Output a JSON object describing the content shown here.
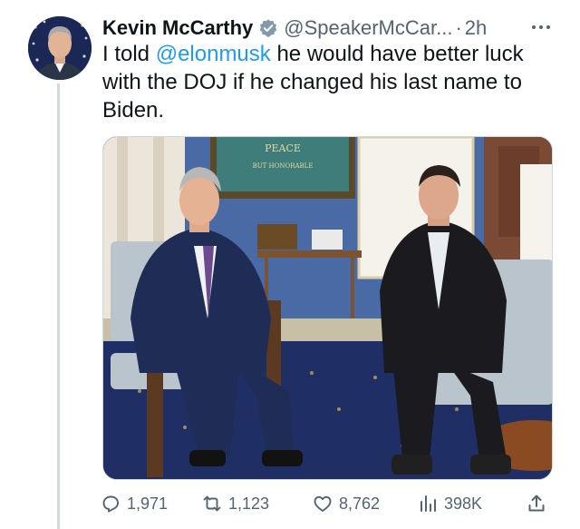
{
  "author": {
    "name": "Kevin McCarthy",
    "handle": "@SpeakerMcCar...",
    "separator": "·",
    "timestamp": "2h",
    "verified_badge_color": "#829aab"
  },
  "tweet": {
    "text_part1": "I told ",
    "mention": "@elonmusk",
    "text_part2": " he would have better luck with the DOJ if he changed his last name to Biden."
  },
  "media": {
    "painting_text_top": "PEACE",
    "painting_text_bottom": "BUT HONORABLE"
  },
  "actions": {
    "replies": "1,971",
    "retweets": "1,123",
    "likes": "8,762",
    "views": "398K"
  },
  "colors": {
    "link": "#1d9bf0",
    "secondary_text": "#536471",
    "thread_line": "#cfd9de"
  }
}
